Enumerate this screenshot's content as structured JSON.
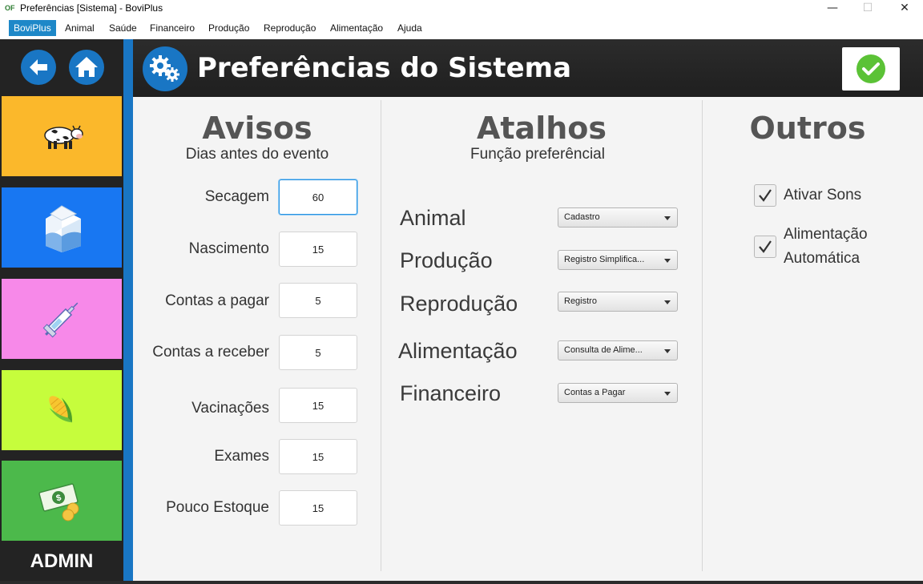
{
  "window": {
    "icon_text": "OF",
    "title": "Preferências [Sistema] - BoviPlus",
    "minimize": "—",
    "maximize": "☐",
    "close": "✕"
  },
  "menu": {
    "items": [
      "BoviPlus",
      "Animal",
      "Saúde",
      "Financeiro",
      "Produção",
      "Reprodução",
      "Alimentação",
      "Ajuda"
    ],
    "active_index": 0
  },
  "sidebar": {
    "nav": [
      "back-arrow-icon",
      "home-icon"
    ],
    "tiles": [
      {
        "name": "animal",
        "icon": "cow-icon",
        "color": "#fbb82b"
      },
      {
        "name": "production",
        "icon": "milk-carton-icon",
        "color": "#1877f2"
      },
      {
        "name": "health",
        "icon": "syringe-icon",
        "color": "#f789e9"
      },
      {
        "name": "feeding",
        "icon": "corn-icon",
        "color": "#c6fd3c"
      },
      {
        "name": "financial",
        "icon": "money-icon",
        "color": "#4cb94b"
      }
    ],
    "admin_label": "ADMIN"
  },
  "header": {
    "icon": "gears-icon",
    "title": "Preferências do Sistema",
    "confirm_icon": "check-circle-icon"
  },
  "avisos": {
    "title": "Avisos",
    "subtitle": "Dias antes do evento",
    "fields": [
      {
        "label": "Secagem",
        "value": "60"
      },
      {
        "label": "Nascimento",
        "value": "15"
      },
      {
        "label": "Contas a pagar",
        "value": "5"
      },
      {
        "label": "Contas a receber",
        "value": "5"
      },
      {
        "label": "Vacinações",
        "value": "15"
      },
      {
        "label": "Exames",
        "value": "15"
      },
      {
        "label": "Pouco Estoque",
        "value": "15"
      }
    ]
  },
  "atalhos": {
    "title": "Atalhos",
    "subtitle": "Função preferêncial",
    "rows": [
      {
        "label": "Animal",
        "value": "Cadastro"
      },
      {
        "label": "Produção",
        "value": "Registro Simplifica..."
      },
      {
        "label": "Reprodução",
        "value": "Registro"
      },
      {
        "label": "Alimentação",
        "value": "Consulta de Alime..."
      },
      {
        "label": "Financeiro",
        "value": "Contas a Pagar"
      }
    ]
  },
  "outros": {
    "title": "Outros",
    "options": [
      {
        "label": "Ativar Sons",
        "checked": true
      },
      {
        "label_line1": "Alimentação",
        "label_line2": "Automática",
        "checked": true
      }
    ]
  }
}
